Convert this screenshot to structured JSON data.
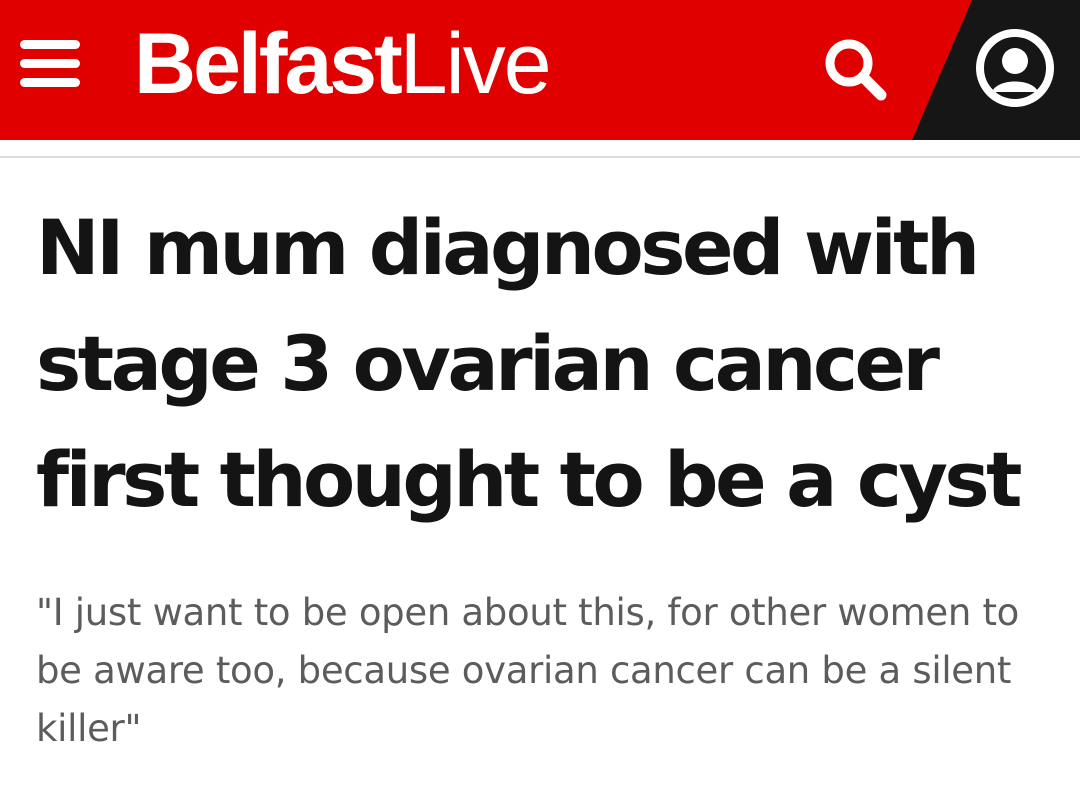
{
  "header": {
    "brand_part_bold": "Belfast",
    "brand_part_light": "Live",
    "background_color": "#e00000",
    "account_area_color": "#161616",
    "menu_icon": "hamburger-menu-icon",
    "search_icon": "search-icon",
    "account_icon": "user-account-icon"
  },
  "article": {
    "headline": "NI mum diagnosed with stage 3 ovarian cancer first thought to be a cyst",
    "standfirst": "\"I just want to be open about this, for other women to be aware too, because ovarian cancer can be a silent killer\""
  }
}
